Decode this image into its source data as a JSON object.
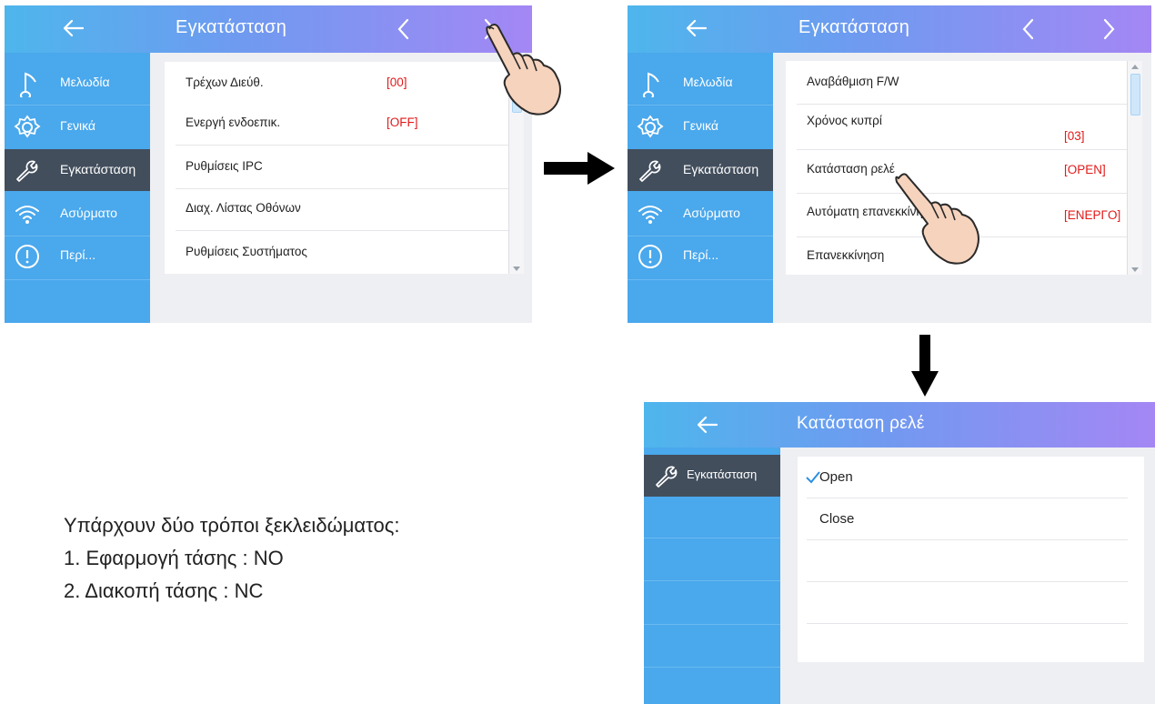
{
  "screen1": {
    "title": "Εγκατάσταση",
    "sidebar": [
      "Μελωδία",
      "Γενικά",
      "Εγκατάσταση",
      "Ασύρματο",
      "Περί..."
    ],
    "rows": [
      {
        "label": "Τρέχων Διεύθ.",
        "value": "[00]"
      },
      {
        "label": "Ενεργή ενδοεπικ.",
        "value": "[OFF]"
      },
      {
        "label": "Ρυθμίσεις IPC",
        "value": ""
      },
      {
        "label": "Διαχ. Λίστας Οθόνων",
        "value": ""
      },
      {
        "label": "Ρυθμίσεις Συστήματος",
        "value": ""
      }
    ]
  },
  "screen2": {
    "title": "Εγκατάσταση",
    "sidebar": [
      "Μελωδία",
      "Γενικά",
      "Εγκατάσταση",
      "Ασύρματο",
      "Περί..."
    ],
    "rows": [
      {
        "label": "Αναβάθμιση F/W",
        "value": ""
      },
      {
        "label": "Χρόνος κυπρί",
        "value": "[03]"
      },
      {
        "label": "Κατάσταση ρελέ",
        "value": "[OPEN]"
      },
      {
        "label": "Αυτόματη επανεκκίνηση",
        "value": "[ΕΝΕΡΓΟ]"
      },
      {
        "label": "Επανεκκίνηση",
        "value": ""
      }
    ]
  },
  "screen3": {
    "title": "Κατάσταση ρελέ",
    "sidebar_label": "Εγκατάσταση",
    "options": [
      {
        "label": "Open",
        "selected": true
      },
      {
        "label": "Close",
        "selected": false
      }
    ]
  },
  "instructions": {
    "line1": "Υπάρχουν δύο τρόποι ξεκλειδώματος:",
    "line2": "1. Εφαρμογή τάσης : ΝΟ",
    "line3": "2. Διακοπή τάσης : NC"
  },
  "icons": {
    "back": "arrow-left-icon",
    "prev": "chevron-left-icon",
    "next": "chevron-right-icon",
    "melody": "music-note-icon",
    "general": "gear-icon",
    "install": "wrench-icon",
    "wireless": "wifi-icon",
    "about": "info-icon",
    "hand": "pointing-hand-icon",
    "flow_right": "arrow-right-icon",
    "flow_down": "arrow-down-icon"
  },
  "colors": {
    "value_red": "#e21a1a",
    "sidebar_blue": "#4aa8ec",
    "active_dark": "#424e5c"
  }
}
